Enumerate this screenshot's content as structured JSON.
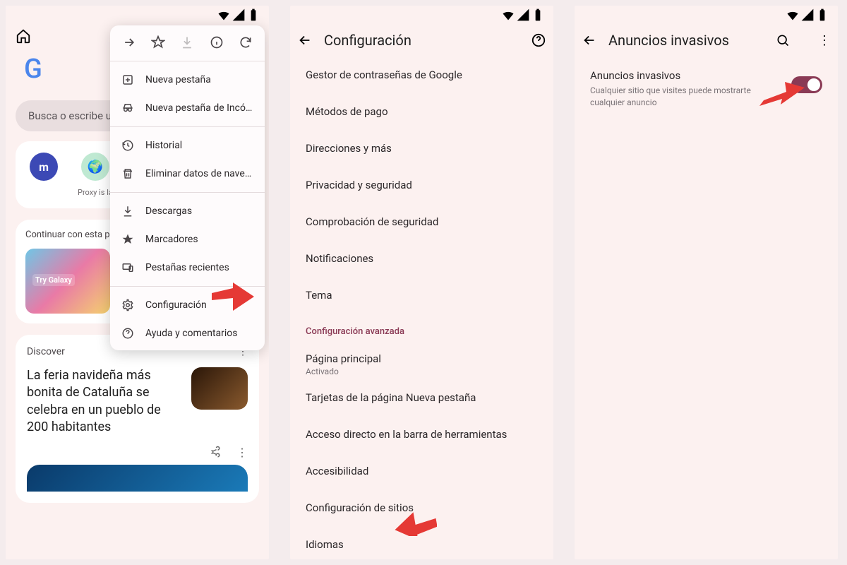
{
  "panel1": {
    "search_placeholder": "Busca o escribe u",
    "shortcut_label": "Proxy is la",
    "continue_header": "Continuar con esta p",
    "discover_header": "Discover",
    "news_headline": "La feria navideña más bonita de Cataluña se celebra en un pueblo de 200 habitantes",
    "menu": {
      "new_tab": "Nueva pestaña",
      "incognito": "Nueva pestaña de Incó…",
      "history": "Historial",
      "clear_data": "Eliminar datos de naveg…",
      "downloads": "Descargas",
      "bookmarks": "Marcadores",
      "recent_tabs": "Pestañas recientes",
      "settings": "Configuración",
      "help": "Ayuda y comentarios"
    }
  },
  "panel2": {
    "title": "Configuración",
    "items": {
      "passwords": "Gestor de contraseñas de Google",
      "payment": "Métodos de pago",
      "addresses": "Direcciones y más",
      "privacy": "Privacidad y seguridad",
      "safety": "Comprobación de seguridad",
      "notifications": "Notificaciones",
      "theme": "Tema",
      "advanced_header": "Configuración avanzada",
      "homepage": "Página principal",
      "homepage_sub": "Activado",
      "ntp_cards": "Tarjetas de la página Nueva pestaña",
      "toolbar_shortcut": "Acceso directo en la barra de herramientas",
      "accessibility": "Accesibilidad",
      "site_settings": "Configuración de sitios",
      "languages": "Idiomas"
    }
  },
  "panel3": {
    "title": "Anuncios invasivos",
    "row_title": "Anuncios invasivos",
    "row_desc": "Cualquier sitio que visites puede mostrarte cualquier anuncio"
  }
}
